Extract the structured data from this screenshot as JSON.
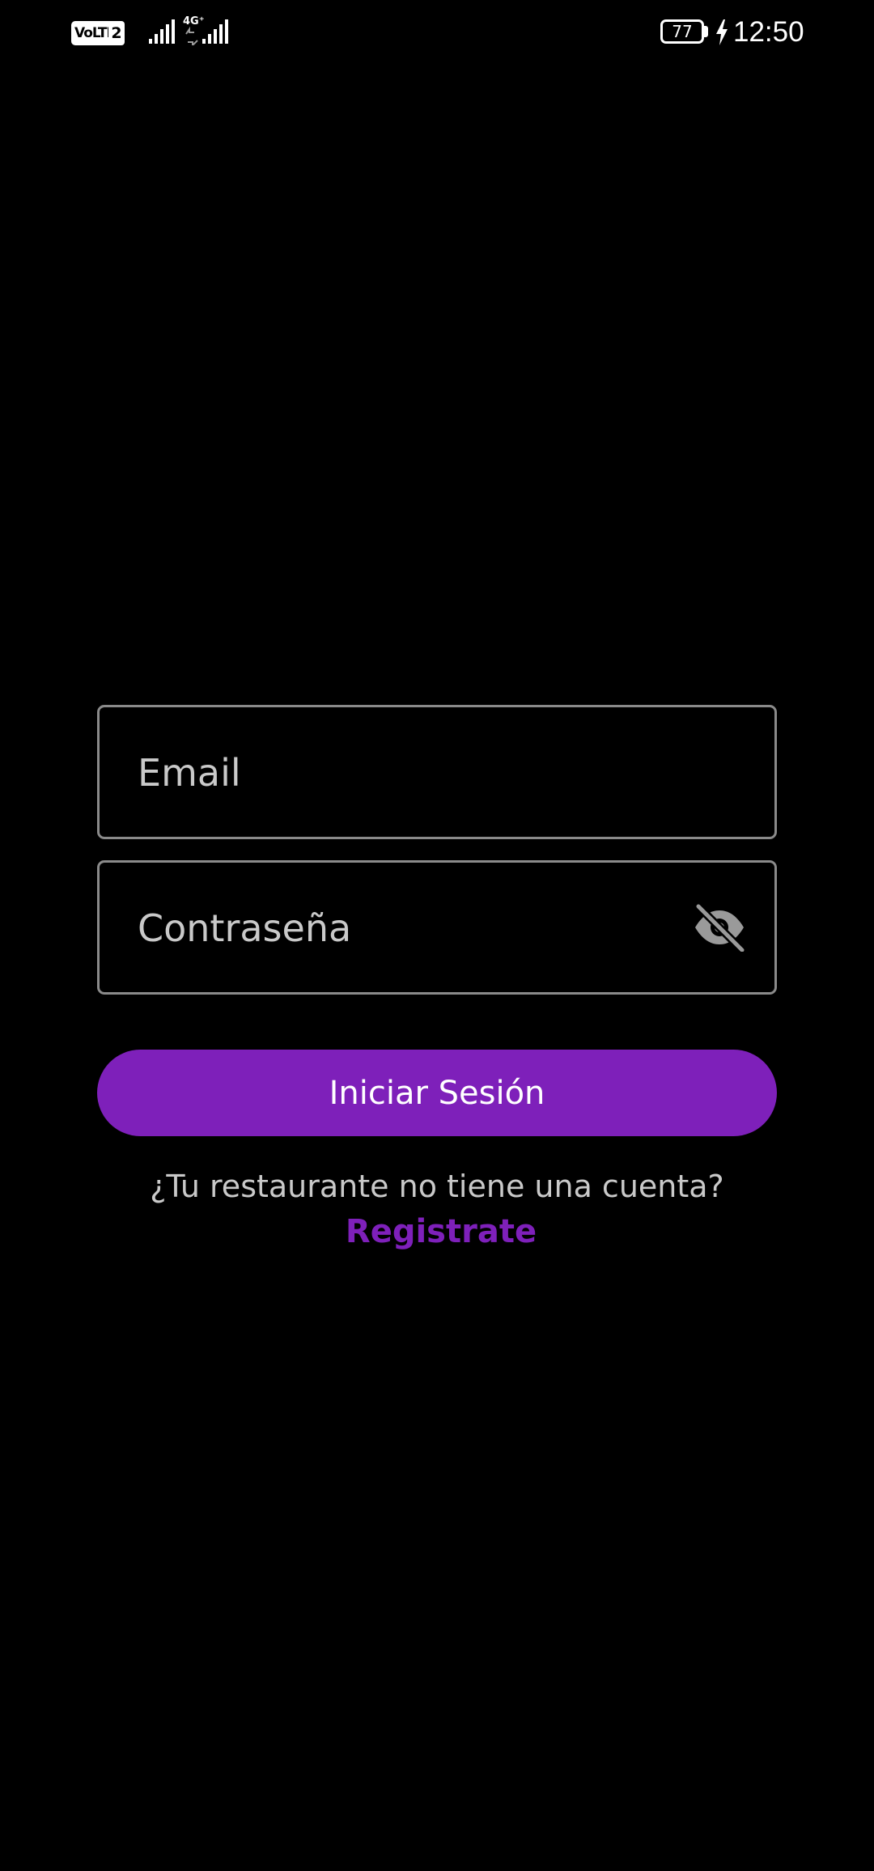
{
  "status_bar": {
    "volte_label": "VoLTE",
    "sim_slot": "2",
    "network_type": "4G⁺",
    "battery_level": "77",
    "time": "12:50",
    "icons": [
      "signal-strength-icon",
      "signal-strength-icon",
      "battery-icon",
      "charging-icon"
    ]
  },
  "login_form": {
    "email_placeholder": "Email",
    "password_placeholder": "Contraseña",
    "password_toggle_icon": "eye-off-icon",
    "submit_label": "Iniciar Sesión",
    "register_prompt": "¿Tu restaurante no tiene una cuenta?",
    "register_link": "Registrate"
  },
  "colors": {
    "background": "#000000",
    "accent": "#7e20ba",
    "field_border": "#8a8a8a",
    "secondary_text": "#c9c9c9"
  }
}
